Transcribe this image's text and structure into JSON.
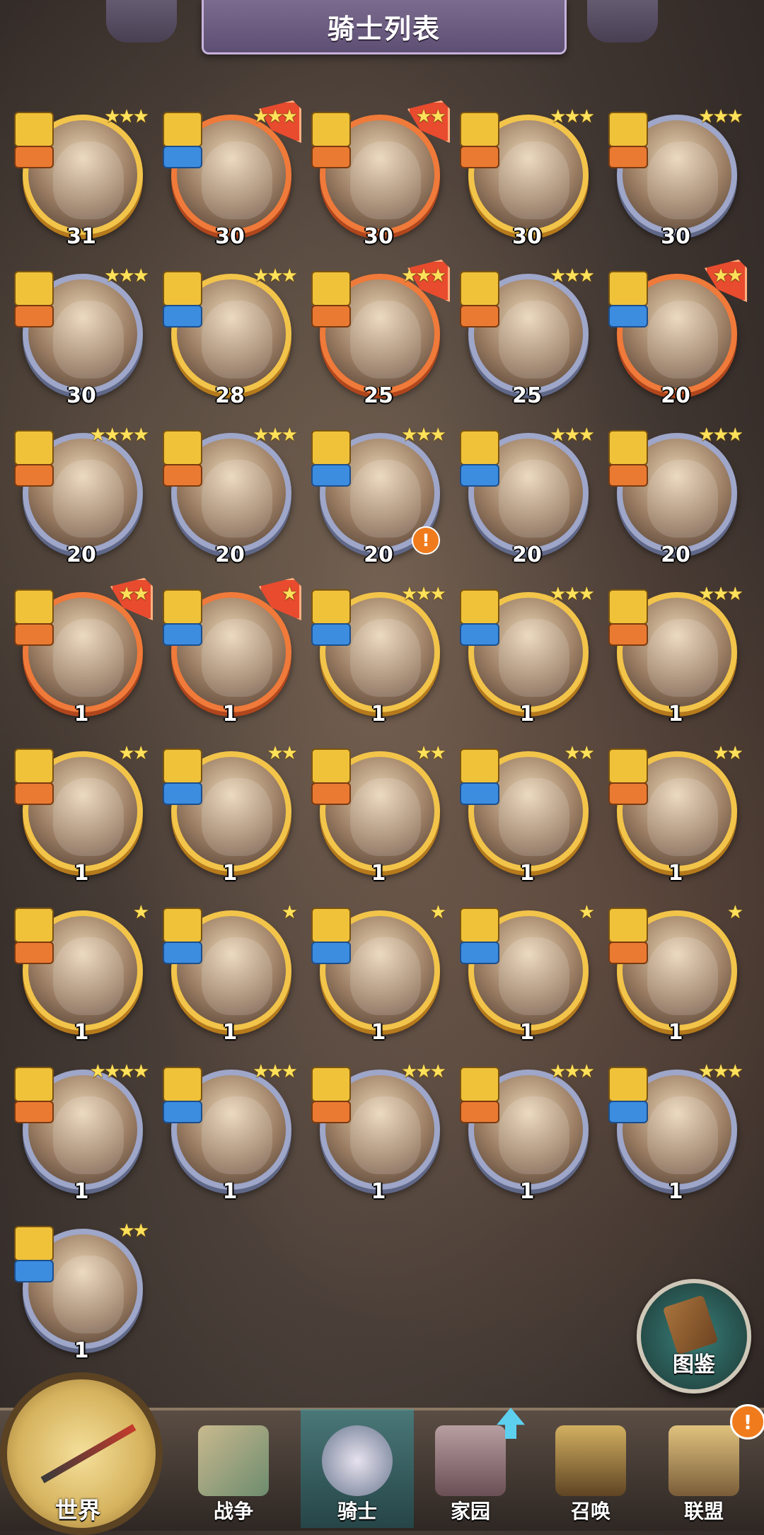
{
  "header": {
    "title": "骑士列表"
  },
  "colors": {
    "gold_ring": "#f2c44a",
    "purple_ring": "#9ea6c9",
    "orange_ring": "#f07a3a"
  },
  "knights": [
    {
      "level": "31",
      "stars": "★★★",
      "ring": "gold",
      "class": "orange",
      "upgrade": false,
      "alert": false
    },
    {
      "level": "30",
      "stars": "★★★",
      "ring": "orange",
      "class": "blue",
      "upgrade": true,
      "alert": false
    },
    {
      "level": "30",
      "stars": "★★",
      "ring": "orange",
      "class": "orange",
      "upgrade": true,
      "alert": false
    },
    {
      "level": "30",
      "stars": "★★★",
      "ring": "gold",
      "class": "orange",
      "upgrade": false,
      "alert": false
    },
    {
      "level": "30",
      "stars": "★★★",
      "ring": "purple",
      "class": "orange",
      "upgrade": false,
      "alert": false
    },
    {
      "level": "30",
      "stars": "★★★",
      "ring": "purple",
      "class": "orange",
      "upgrade": false,
      "alert": false
    },
    {
      "level": "28",
      "stars": "★★★",
      "ring": "gold",
      "class": "blue",
      "upgrade": false,
      "alert": false
    },
    {
      "level": "25",
      "stars": "★★★",
      "ring": "orange",
      "class": "orange",
      "upgrade": true,
      "alert": false
    },
    {
      "level": "25",
      "stars": "★★★",
      "ring": "purple",
      "class": "orange",
      "upgrade": false,
      "alert": false
    },
    {
      "level": "20",
      "stars": "★★",
      "ring": "orange",
      "class": "blue",
      "upgrade": true,
      "alert": false
    },
    {
      "level": "20",
      "stars": "★★★★",
      "ring": "purple",
      "class": "orange",
      "upgrade": false,
      "alert": false
    },
    {
      "level": "20",
      "stars": "★★★",
      "ring": "purple",
      "class": "orange",
      "upgrade": false,
      "alert": false
    },
    {
      "level": "20",
      "stars": "★★★",
      "ring": "purple",
      "class": "blue",
      "upgrade": false,
      "alert": true
    },
    {
      "level": "20",
      "stars": "★★★",
      "ring": "purple",
      "class": "blue",
      "upgrade": false,
      "alert": false
    },
    {
      "level": "20",
      "stars": "★★★",
      "ring": "purple",
      "class": "orange",
      "upgrade": false,
      "alert": false
    },
    {
      "level": "1",
      "stars": "★★",
      "ring": "orange",
      "class": "orange",
      "upgrade": true,
      "alert": false
    },
    {
      "level": "1",
      "stars": "★",
      "ring": "orange",
      "class": "blue",
      "upgrade": true,
      "alert": false
    },
    {
      "level": "1",
      "stars": "★★★",
      "ring": "gold",
      "class": "blue",
      "upgrade": false,
      "alert": false
    },
    {
      "level": "1",
      "stars": "★★★",
      "ring": "gold",
      "class": "blue",
      "upgrade": false,
      "alert": false
    },
    {
      "level": "1",
      "stars": "★★★",
      "ring": "gold",
      "class": "orange",
      "upgrade": false,
      "alert": false
    },
    {
      "level": "1",
      "stars": "★★",
      "ring": "gold",
      "class": "orange",
      "upgrade": false,
      "alert": false
    },
    {
      "level": "1",
      "stars": "★★",
      "ring": "gold",
      "class": "blue",
      "upgrade": false,
      "alert": false
    },
    {
      "level": "1",
      "stars": "★★",
      "ring": "gold",
      "class": "orange",
      "upgrade": false,
      "alert": false
    },
    {
      "level": "1",
      "stars": "★★",
      "ring": "gold",
      "class": "blue",
      "upgrade": false,
      "alert": false
    },
    {
      "level": "1",
      "stars": "★★",
      "ring": "gold",
      "class": "orange",
      "upgrade": false,
      "alert": false
    },
    {
      "level": "1",
      "stars": "★",
      "ring": "gold",
      "class": "orange",
      "upgrade": false,
      "alert": false
    },
    {
      "level": "1",
      "stars": "★",
      "ring": "gold",
      "class": "blue",
      "upgrade": false,
      "alert": false
    },
    {
      "level": "1",
      "stars": "★",
      "ring": "gold",
      "class": "blue",
      "upgrade": false,
      "alert": false
    },
    {
      "level": "1",
      "stars": "★",
      "ring": "gold",
      "class": "blue",
      "upgrade": false,
      "alert": false
    },
    {
      "level": "1",
      "stars": "★",
      "ring": "gold",
      "class": "orange",
      "upgrade": false,
      "alert": false
    },
    {
      "level": "1",
      "stars": "★★★★",
      "ring": "purple",
      "class": "orange",
      "upgrade": false,
      "alert": false
    },
    {
      "level": "1",
      "stars": "★★★",
      "ring": "purple",
      "class": "blue",
      "upgrade": false,
      "alert": false
    },
    {
      "level": "1",
      "stars": "★★★",
      "ring": "purple",
      "class": "orange",
      "upgrade": false,
      "alert": false
    },
    {
      "level": "1",
      "stars": "★★★",
      "ring": "purple",
      "class": "orange",
      "upgrade": false,
      "alert": false
    },
    {
      "level": "1",
      "stars": "★★★",
      "ring": "purple",
      "class": "blue",
      "upgrade": false,
      "alert": false
    },
    {
      "level": "1",
      "stars": "★★",
      "ring": "purple",
      "class": "blue",
      "upgrade": false,
      "alert": false
    }
  ],
  "atlas": {
    "label": "图鉴"
  },
  "nav": {
    "world": "世界",
    "war": "战争",
    "knight": "骑士",
    "home": "家园",
    "summon": "召唤",
    "alliance": "联盟",
    "alert_mark": "!"
  }
}
